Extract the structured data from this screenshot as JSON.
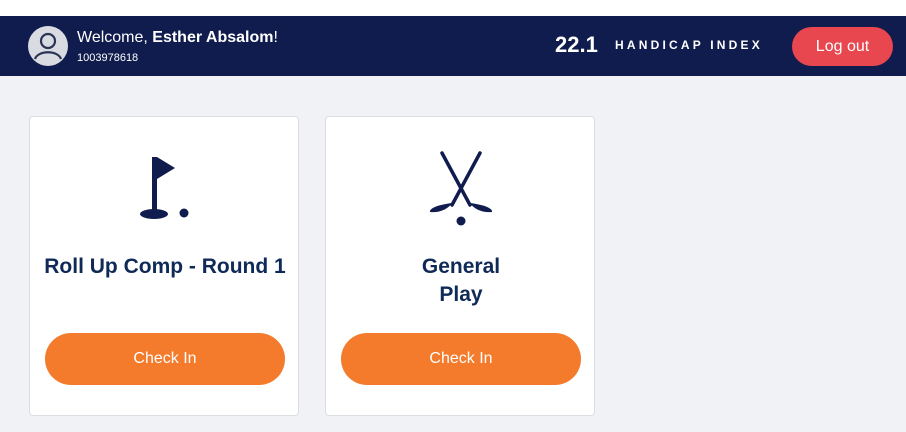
{
  "header": {
    "welcome_prefix": "Welcome, ",
    "user_name": "Esther Absalom",
    "welcome_suffix": "!",
    "member_id": "1003978618",
    "handicap_value": "22.1",
    "handicap_label": "HANDICAP INDEX",
    "logout_label": "Log out"
  },
  "cards": [
    {
      "title": "Roll Up Comp - Round 1",
      "button_label": "Check In",
      "icon": "golf-flag-icon"
    },
    {
      "title": "General Play",
      "button_label": "Check In",
      "icon": "golf-clubs-icon"
    }
  ],
  "colors": {
    "header_bg": "#0f1c4d",
    "logout": "#e8474f",
    "checkin": "#f47b2c",
    "title_text": "#0f2a57"
  }
}
